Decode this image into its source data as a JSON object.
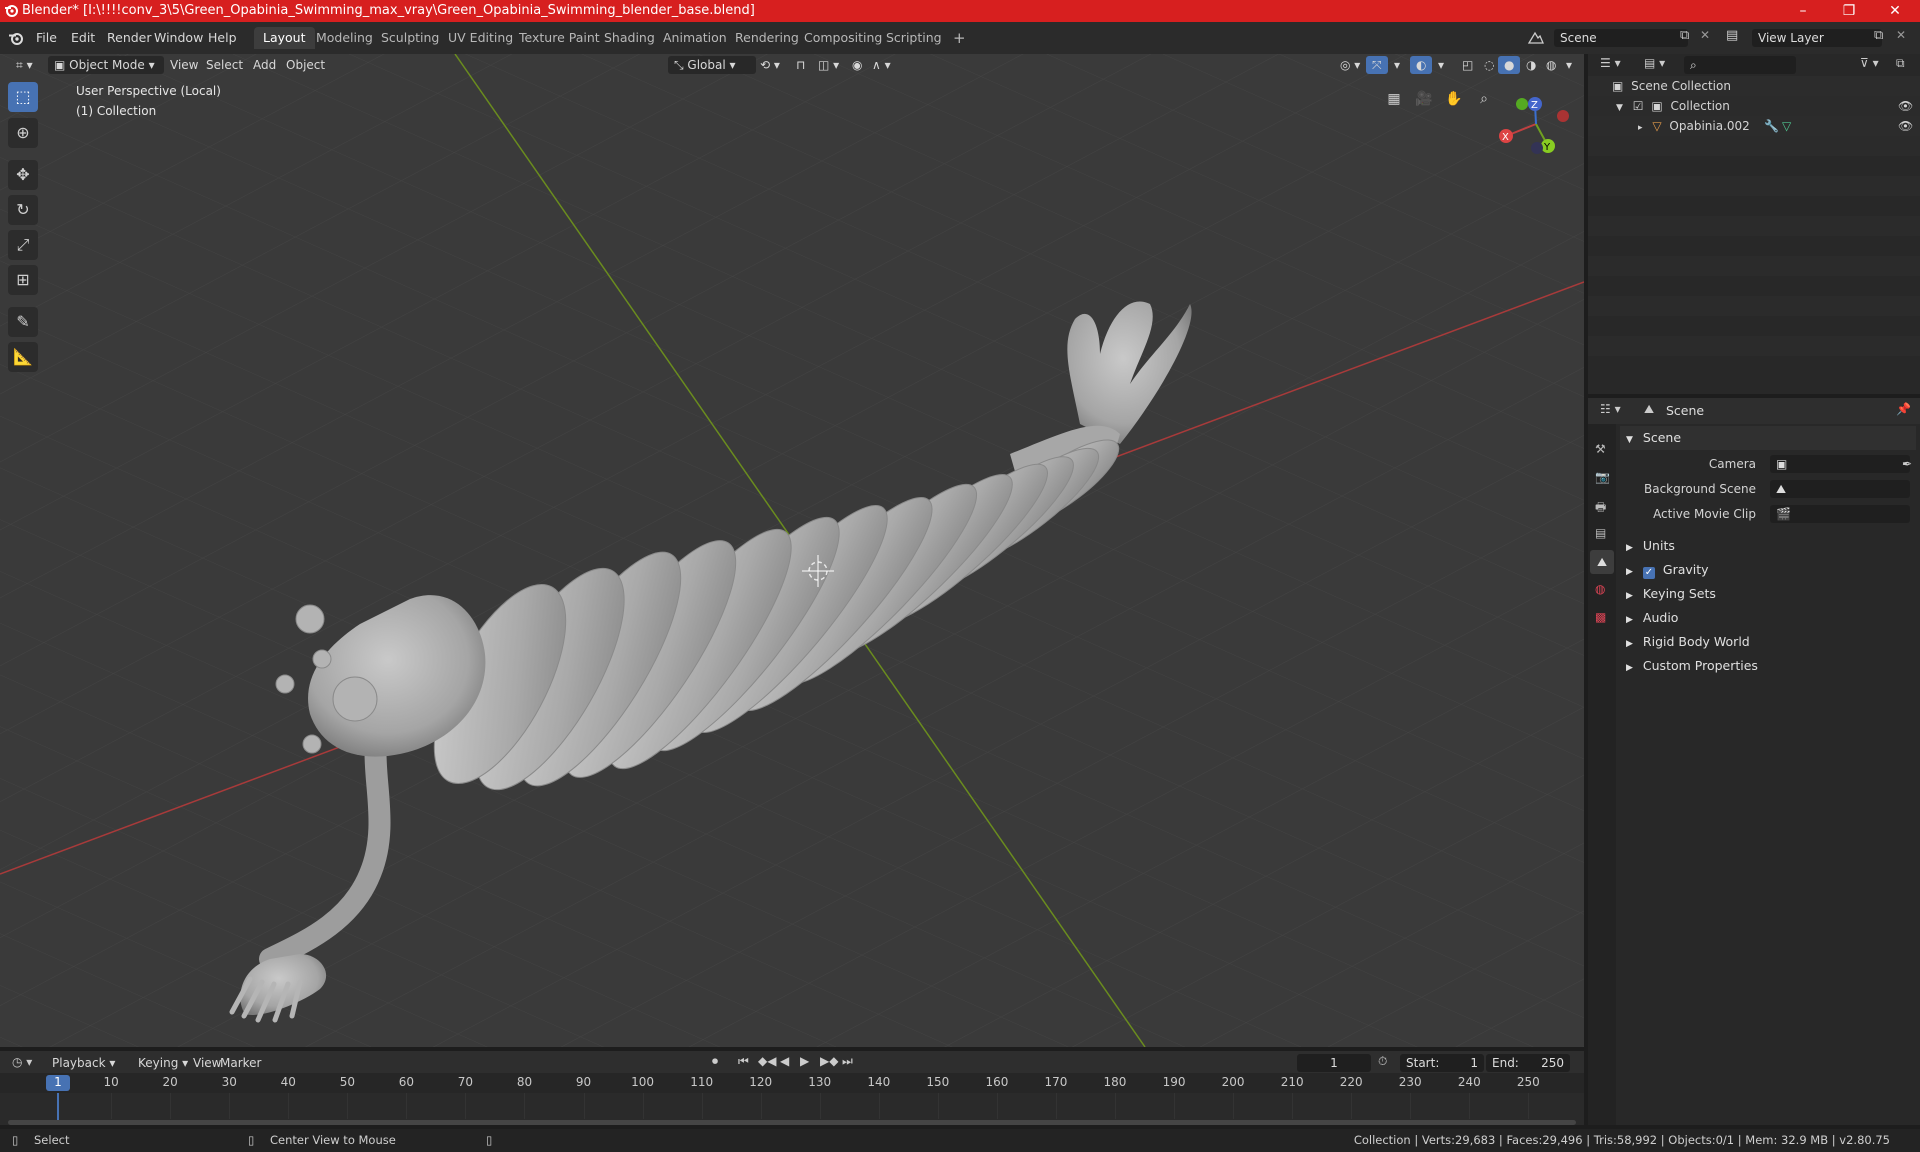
{
  "window": {
    "title": "Blender* [I:\\!!!!conv_3\\5\\Green_Opabinia_Swimming_max_vray\\Green_Opabinia_Swimming_blender_base.blend]",
    "minimize": "–",
    "restore": "❐",
    "close": "✕"
  },
  "menubar": {
    "menus": [
      "File",
      "Edit",
      "Render",
      "Window",
      "Help"
    ],
    "workspaces": [
      "Layout",
      "Modeling",
      "Sculpting",
      "UV Editing",
      "Texture Paint",
      "Shading",
      "Animation",
      "Rendering",
      "Compositing",
      "Scripting"
    ],
    "active_workspace": "Layout",
    "add_workspace": "+",
    "scene_name": "Scene",
    "view_layer_name": "View Layer"
  },
  "viewport": {
    "mode": "Object Mode",
    "menus": [
      "View",
      "Select",
      "Add",
      "Object"
    ],
    "transform_orientation": "Global",
    "perspective_label": "User Perspective (Local)",
    "collection_label": "(1) Collection",
    "gizmo": {
      "x": "X",
      "y": "Y",
      "z": "Z"
    },
    "tools": [
      "select-box",
      "cursor",
      "move",
      "rotate",
      "scale",
      "transform",
      "annotate",
      "measure"
    ]
  },
  "outliner": {
    "root": "Scene Collection",
    "collection": "Collection",
    "object": "Opabinia.002"
  },
  "properties": {
    "header": "Scene",
    "section_title": "Scene",
    "fields": [
      {
        "label": "Camera",
        "value": ""
      },
      {
        "label": "Background Scene",
        "value": ""
      },
      {
        "label": "Active Movie Clip",
        "value": ""
      }
    ],
    "subsections": [
      {
        "label": "Units",
        "checkbox": false
      },
      {
        "label": "Gravity",
        "checkbox": true
      },
      {
        "label": "Keying Sets",
        "checkbox": false
      },
      {
        "label": "Audio",
        "checkbox": false
      },
      {
        "label": "Rigid Body World",
        "checkbox": false
      },
      {
        "label": "Custom Properties",
        "checkbox": false
      }
    ]
  },
  "timeline": {
    "menus": [
      "Playback",
      "Keying",
      "View",
      "Marker"
    ],
    "current_frame": "1",
    "start_label": "Start:",
    "start_value": "1",
    "end_label": "End:",
    "end_value": "250",
    "ticks": [
      "1",
      "10",
      "20",
      "30",
      "40",
      "50",
      "60",
      "70",
      "80",
      "90",
      "100",
      "110",
      "120",
      "130",
      "140",
      "150",
      "160",
      "170",
      "180",
      "190",
      "200",
      "210",
      "220",
      "230",
      "240",
      "250"
    ]
  },
  "statusbar": {
    "left_action": "Select",
    "middle_action": "Center View to Mouse",
    "stats": "Collection | Verts:29,683 | Faces:29,496 | Tris:58,992 | Objects:0/1 | Mem: 32.9 MB | v2.80.75"
  }
}
